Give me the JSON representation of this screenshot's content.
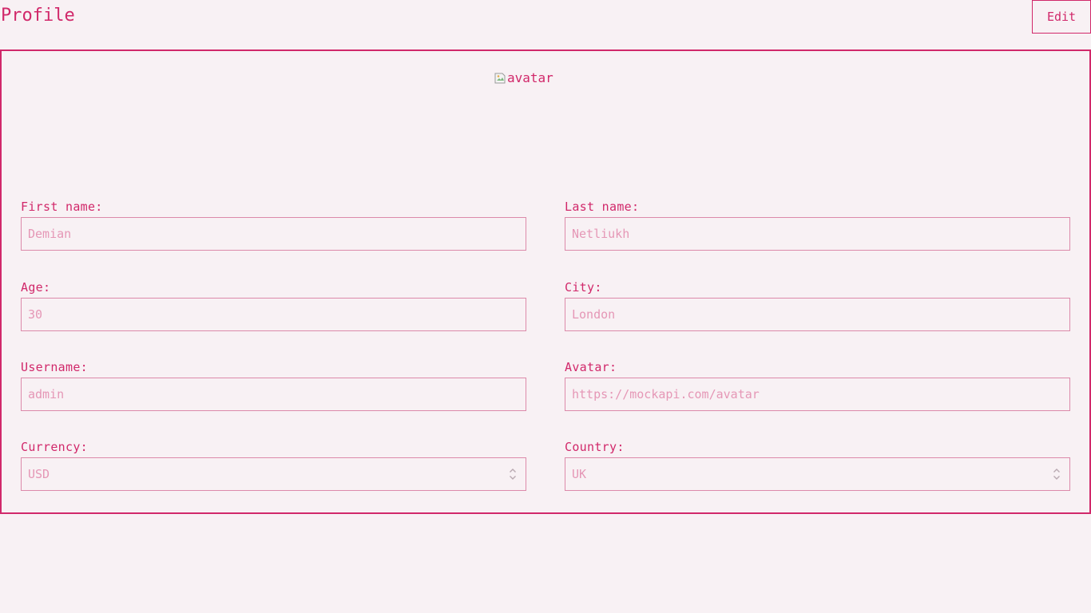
{
  "header": {
    "title": "Profile",
    "edit_label": "Edit"
  },
  "avatar": {
    "alt": "avatar"
  },
  "form": {
    "first_name": {
      "label": "First name:",
      "value": "Demian"
    },
    "last_name": {
      "label": "Last name:",
      "value": "Netliukh"
    },
    "age": {
      "label": "Age:",
      "value": "30"
    },
    "city": {
      "label": "City:",
      "value": "London"
    },
    "username": {
      "label": "Username:",
      "value": "admin"
    },
    "avatar_url": {
      "label": "Avatar:",
      "value": "https://mockapi.com/avatar"
    },
    "currency": {
      "label": "Currency:",
      "selected": "USD"
    },
    "country": {
      "label": "Country:",
      "selected": "UK"
    }
  },
  "colors": {
    "accent": "#d1286a",
    "background": "#f8f1f4",
    "input_border": "#dc8aaa",
    "input_text": "#e597b6"
  },
  "icons": {
    "avatar": "broken-image-icon",
    "select": "chevron-updown-icon"
  }
}
